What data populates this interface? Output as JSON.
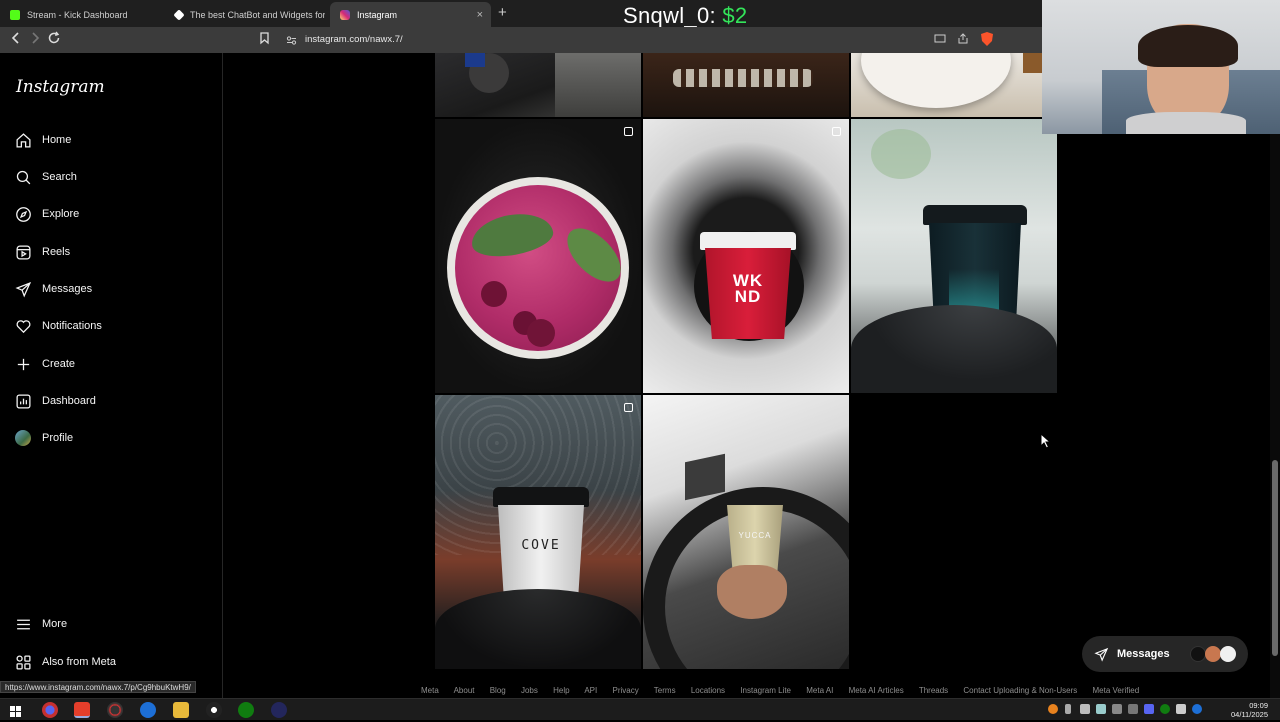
{
  "browser": {
    "tabs": [
      {
        "title": "Stream - Kick Dashboard",
        "fav_color": "#53fc18",
        "active": false
      },
      {
        "title": "The best ChatBot and Widgets for Ki",
        "fav_color": "#ffffff",
        "active": false
      },
      {
        "title": "Instagram",
        "fav_color": "#e1306c",
        "active": true
      }
    ],
    "close_glyph": "×",
    "new_tab_glyph": "+",
    "url": "instagram.com/nawx.7/",
    "status_url": "https://www.instagram.com/nawx.7/p/Cg9hbuKtwH9/"
  },
  "stream_overlay": {
    "label": "Snqwl_0: ",
    "amount": "$2"
  },
  "sidebar": {
    "logo": "Instagram",
    "items": [
      {
        "label": "Home",
        "icon": "home-icon"
      },
      {
        "label": "Search",
        "icon": "search-icon"
      },
      {
        "label": "Explore",
        "icon": "compass-icon"
      },
      {
        "label": "Reels",
        "icon": "reels-icon"
      },
      {
        "label": "Messages",
        "icon": "send-icon"
      },
      {
        "label": "Notifications",
        "icon": "heart-icon"
      },
      {
        "label": "Create",
        "icon": "plus-icon"
      },
      {
        "label": "Dashboard",
        "icon": "chart-icon"
      },
      {
        "label": "Profile",
        "icon": "avatar-icon"
      }
    ],
    "more": "More",
    "also_from_meta": "Also from Meta"
  },
  "grid": {
    "cup_texts": {
      "wknd": "WK ND",
      "cove": "COVE",
      "yucca": "YUCCA"
    }
  },
  "messages_pill": {
    "label": "Messages"
  },
  "footer": {
    "links": [
      "Meta",
      "About",
      "Blog",
      "Jobs",
      "Help",
      "API",
      "Privacy",
      "Terms",
      "Locations",
      "Instagram Lite",
      "Meta AI",
      "Meta AI Articles",
      "Threads",
      "Contact Uploading & Non-Users",
      "Meta Verified"
    ]
  },
  "taskbar": {
    "time": "09:09",
    "date": "04/11/2025"
  },
  "colors": {
    "accent_green": "#33e55a",
    "bg": "#000000"
  }
}
